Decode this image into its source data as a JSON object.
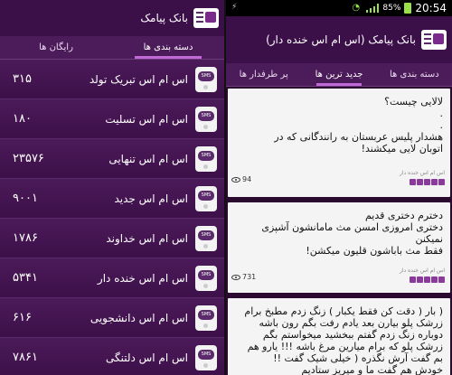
{
  "left": {
    "title": "بانک پیامک",
    "tabs": [
      "دسته بندی ها",
      "رایگان ها"
    ],
    "categories": [
      {
        "label": "اس ام اس تبریک تولد",
        "count": "۳۱۵"
      },
      {
        "label": "اس ام اس تسلیت",
        "count": "۱۸۰"
      },
      {
        "label": "اس ام اس تنهایی",
        "count": "۲۳۵۷۶"
      },
      {
        "label": "اس ام اس جدید",
        "count": "۹۰۰۱"
      },
      {
        "label": "اس ام اس خداوند",
        "count": "۱۷۸۶"
      },
      {
        "label": "اس ام اس خنده دار",
        "count": "۵۳۴۱"
      },
      {
        "label": "اس ام اس دانشجویی",
        "count": "۶۱۶"
      },
      {
        "label": "اس ام اس دلتنگی",
        "count": "۷۸۶۱"
      }
    ],
    "sms_icon_text": "SMS"
  },
  "right": {
    "status": {
      "battery": "85%",
      "clock": "20:54"
    },
    "title": "بانک پیامک (اس ام اس خنده دار)",
    "tabs": [
      "دسته بندی ها",
      "جدید ترین ها",
      "پر طرفدار ها"
    ],
    "posts": [
      {
        "text": "لالایی چیست؟\n.\n.\nهشدار پلیس عربستان به رانندگانی که در\nاتوبان لایی میکشند!",
        "meta": "اس ام اس خنده دار",
        "views": "94",
        "stars": 5
      },
      {
        "text": "دخترم دختری قدیم\nدختری امروزی امسن مث مامانشون آشپزی\nنمیکنن\nفقط مث باباشون قلیون میکشن!",
        "meta": "اس ام اس خنده دار",
        "views": "731",
        "stars": 5
      },
      {
        "text": "( بار ( دقت کن فقط یکبار ) زنگ زدم مطبخ برام\nزرشک پلو بیارن بعد یادم رفت بگم رون باشه\nدوباره زنگ زدم گفتم ببخشید میخواستم بگم\nزرشک پلو که برام میارین مرغ باشه !!! یارو هم\nبم گفت آرش نگذره ( خیلی شیک گفت !!\nخودش هم گفت ما و میریز ستادیم",
        "meta": "",
        "views": "",
        "stars": 0
      }
    ]
  },
  "colors": {
    "accent": "#c06ad8",
    "purple": "#4b1a59",
    "star": "#8a3a9a"
  }
}
